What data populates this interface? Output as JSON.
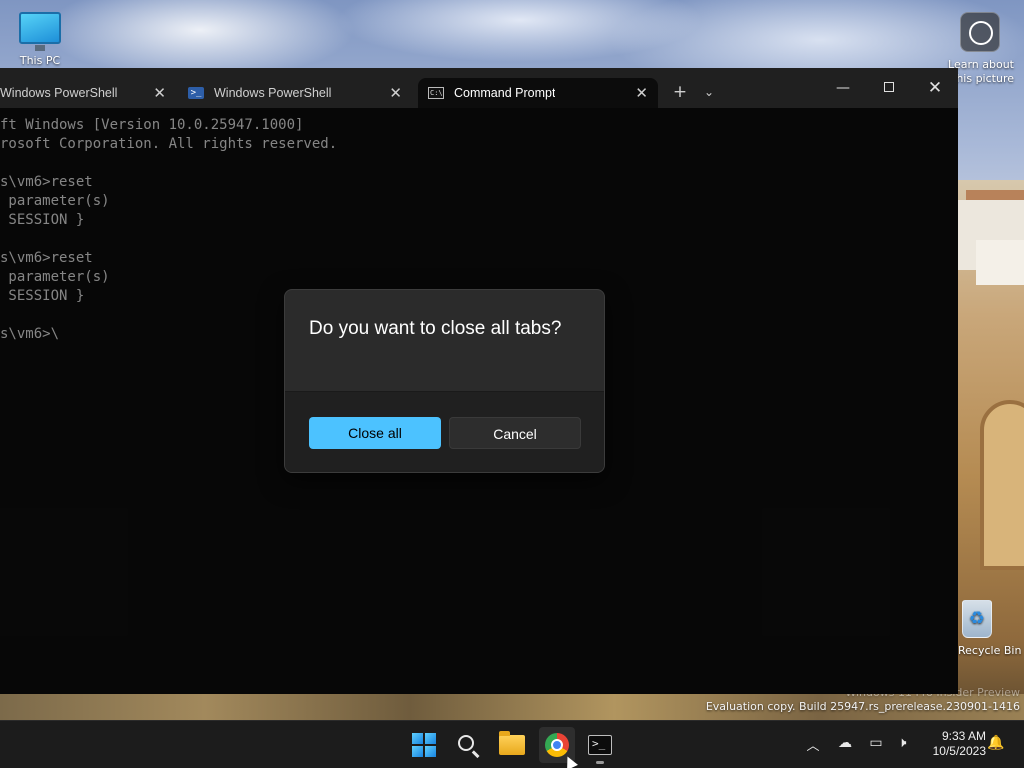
{
  "desktop": {
    "icons": {
      "this_pc": "This PC",
      "learn_line1": "Learn about",
      "learn_line2": "this picture",
      "recycle_bin": "Recycle Bin"
    },
    "watermark": {
      "line1": "Windows 11 Pro Insider Preview",
      "line2": "Evaluation copy. Build 25947.rs_prerelease.230901-1416"
    }
  },
  "terminal": {
    "tabs": [
      {
        "label": "Windows PowerShell",
        "icon": "powershell-icon",
        "active": false
      },
      {
        "label": "Windows PowerShell",
        "icon": "powershell-icon",
        "active": false
      },
      {
        "label": "Command Prompt",
        "icon": "cmd-icon",
        "active": true
      }
    ],
    "new_tab_symbol": "+",
    "dropdown_symbol": "⌄",
    "console_lines": [
      "ft Windows [Version 10.0.25947.1000]",
      "rosoft Corporation. All rights reserved.",
      "",
      "s\\vm6>reset",
      " parameter(s)",
      " SESSION }",
      "",
      "s\\vm6>reset",
      " parameter(s)",
      " SESSION }",
      "",
      "s\\vm6>\\"
    ]
  },
  "dialog": {
    "title": "Do you want to close all tabs?",
    "primary_label": "Close all",
    "secondary_label": "Cancel",
    "accent_color": "#4cc2ff"
  },
  "taskbar": {
    "apps": [
      "start-icon",
      "search-icon",
      "file-explorer-icon",
      "chrome-icon",
      "terminal-icon"
    ],
    "clock_time": "9:33 AM",
    "clock_date": "10/5/2023"
  }
}
